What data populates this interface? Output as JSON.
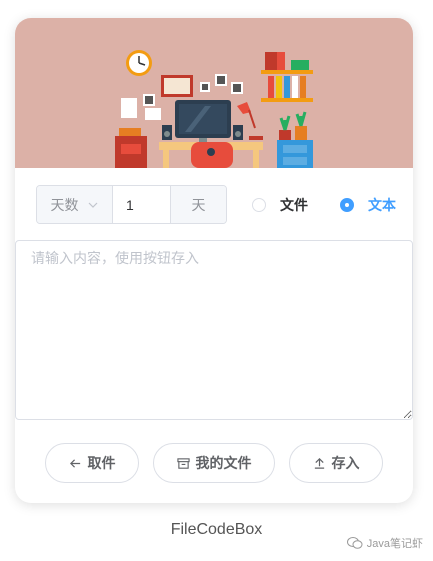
{
  "settings": {
    "duration_unit_select": "天数",
    "duration_value": "1",
    "duration_suffix": "天",
    "type_options": [
      {
        "label": "文件",
        "checked": false
      },
      {
        "label": "文本",
        "checked": true
      }
    ]
  },
  "content": {
    "placeholder": "请输入内容，使用按钮存入",
    "value": ""
  },
  "actions": {
    "fetch_label": "取件",
    "my_files_label": "我的文件",
    "save_label": "存入"
  },
  "footer": {
    "app_name": "FileCodeBox"
  },
  "watermark": {
    "text": "Java笔记虾"
  },
  "colors": {
    "accent": "#409eff",
    "banner_bg": "#dcb1a7"
  }
}
